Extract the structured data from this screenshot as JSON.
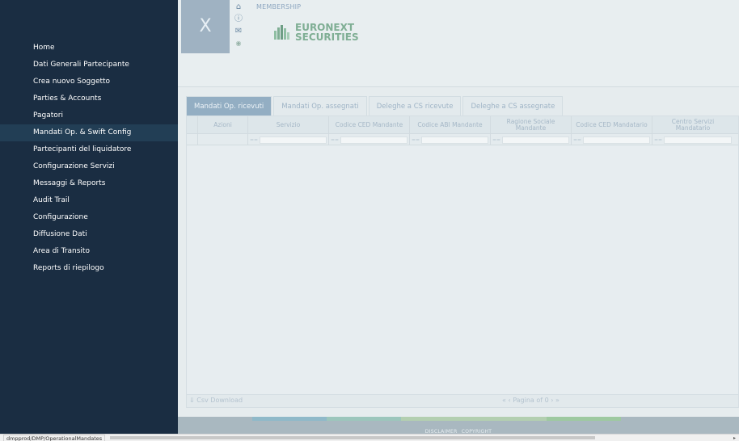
{
  "sidebar": {
    "items": [
      {
        "label": "Home"
      },
      {
        "label": "Dati Generali Partecipante"
      },
      {
        "label": "Crea nuovo Soggetto"
      },
      {
        "label": "Parties & Accounts"
      },
      {
        "label": "Pagatori"
      },
      {
        "label": "Mandati Op. & Swift Config",
        "active": true
      },
      {
        "label": "Partecipanti del liquidatore"
      },
      {
        "label": "Configurazione Servizi"
      },
      {
        "label": "Messaggi & Reports"
      },
      {
        "label": "Audit Trail"
      },
      {
        "label": "Configurazione"
      },
      {
        "label": "Diffusione Dati"
      },
      {
        "label": "Area di Transito"
      },
      {
        "label": "Reports di riepilogo"
      }
    ]
  },
  "header": {
    "close_label": "X",
    "membership": "MEMBERSHIP",
    "brand_line1": "EURONEXT",
    "brand_line2": "SECURITIES",
    "icons": [
      "home-icon",
      "info-icon",
      "mail-icon",
      "globe-icon"
    ]
  },
  "tabs": [
    {
      "label": "Mandati Op. ricevuti",
      "active": true
    },
    {
      "label": "Mandati Op. assegnati"
    },
    {
      "label": "Deleghe a CS ricevute"
    },
    {
      "label": "Deleghe a CS assegnate"
    }
  ],
  "grid": {
    "columns": [
      {
        "label": "Azioni"
      },
      {
        "label": "Servizio"
      },
      {
        "label": "Codice CED Mandante"
      },
      {
        "label": "Codice ABI Mandante"
      },
      {
        "label": "Ragione Sociale Mandante"
      },
      {
        "label": "Codice CED Mandatario"
      },
      {
        "label": "Centro Servizi Mandatario"
      }
    ],
    "filter_op": "==",
    "rows": []
  },
  "footer": {
    "csv_download": "Csv Download",
    "pager_label": "Pagina",
    "pager_nav_prev": "« ‹",
    "pager_nav_next": "of 0 › »"
  },
  "bottom": {
    "disclaimer": "DISCLAIMER",
    "copyright": "COPYRIGHT"
  },
  "status": {
    "url": "dmpprod/DMP/OperationalMandates"
  },
  "colors": {
    "sidebar_bg": "#1a2d42",
    "active_tab": "#93aec3",
    "brand_green": "#7fae94"
  }
}
